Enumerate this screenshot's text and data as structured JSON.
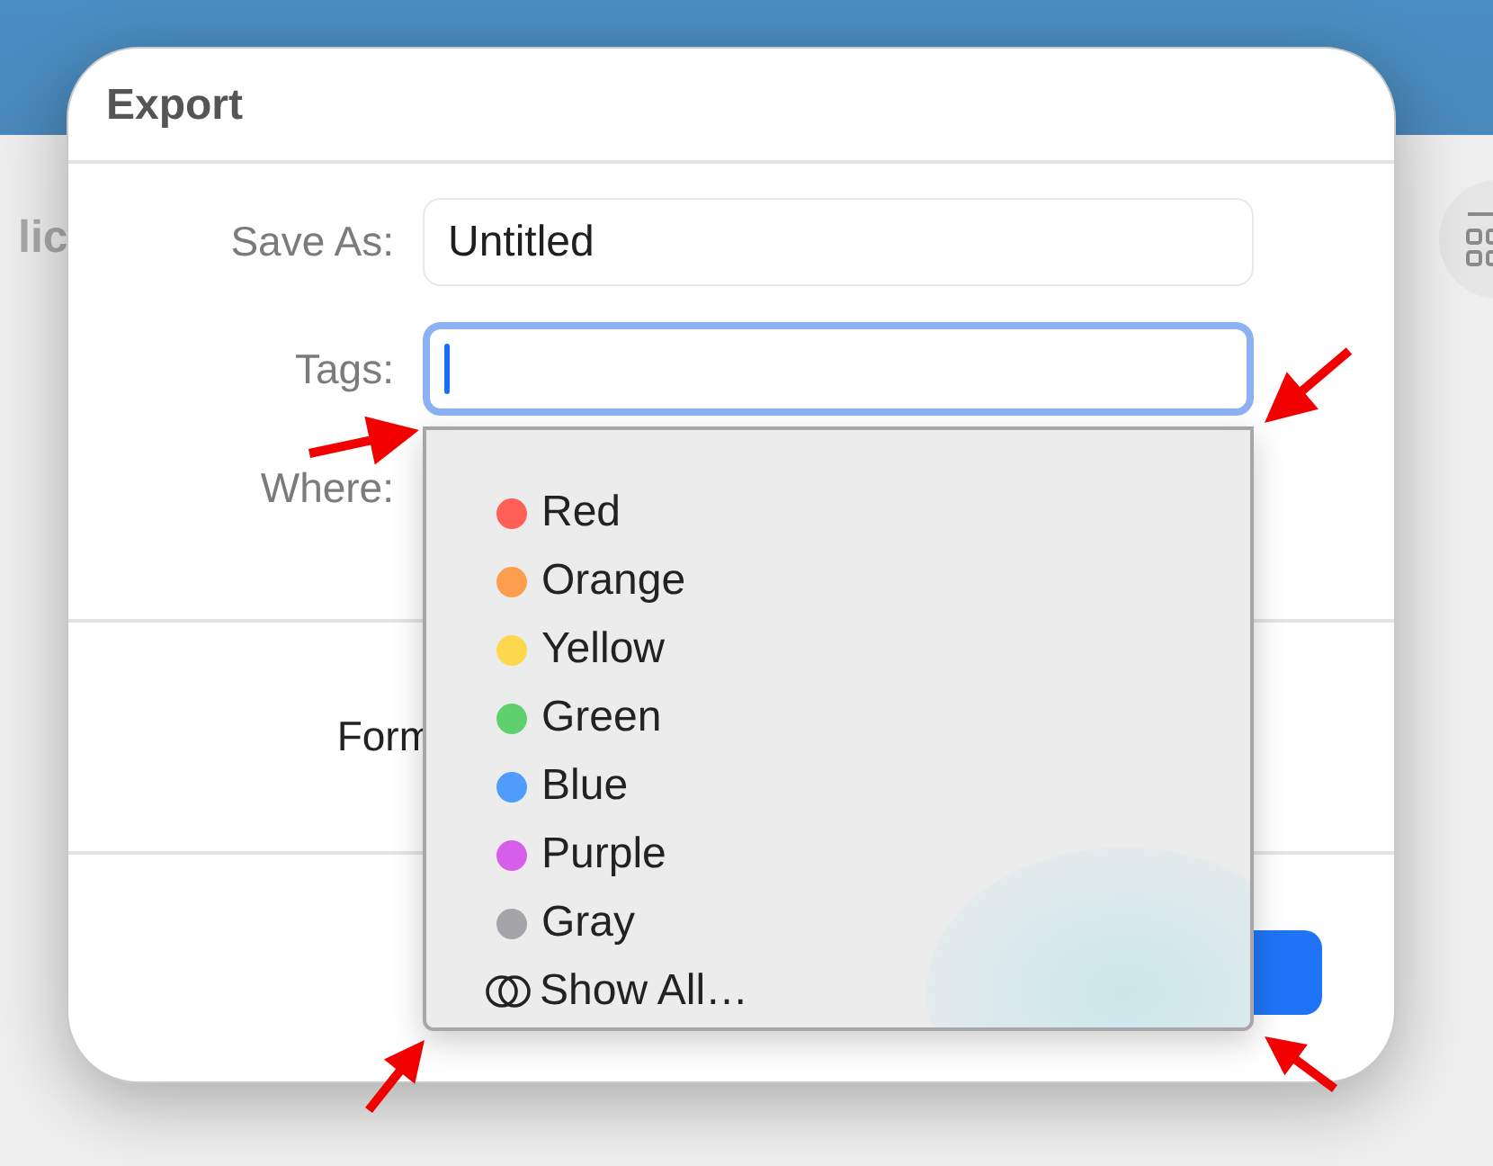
{
  "background": {
    "partial_label": "lic"
  },
  "dialog": {
    "title": "Export",
    "fields": [
      {
        "label": "Save As:",
        "kind": "text",
        "value": "Untitled",
        "focused": false
      },
      {
        "label": "Tags:",
        "kind": "text",
        "focused": true
      },
      {
        "label": "Where:",
        "kind": "covered"
      }
    ],
    "format_label": "Form"
  },
  "tag_menu": {
    "items": [
      {
        "label": "Red",
        "kind": "tag",
        "color": "#fe5f57"
      },
      {
        "label": "Orange",
        "kind": "tag",
        "color": "#fd9e4f"
      },
      {
        "label": "Yellow",
        "kind": "tag",
        "color": "#fdd84c"
      },
      {
        "label": "Green",
        "kind": "tag",
        "color": "#5fd06e"
      },
      {
        "label": "Blue",
        "kind": "tag",
        "color": "#4e9cfd"
      },
      {
        "label": "Purple",
        "kind": "tag",
        "color": "#d55fe8"
      },
      {
        "label": "Gray",
        "kind": "tag",
        "color": "#a3a3a8"
      },
      {
        "label": "Show All…",
        "kind": "show_all"
      }
    ]
  }
}
